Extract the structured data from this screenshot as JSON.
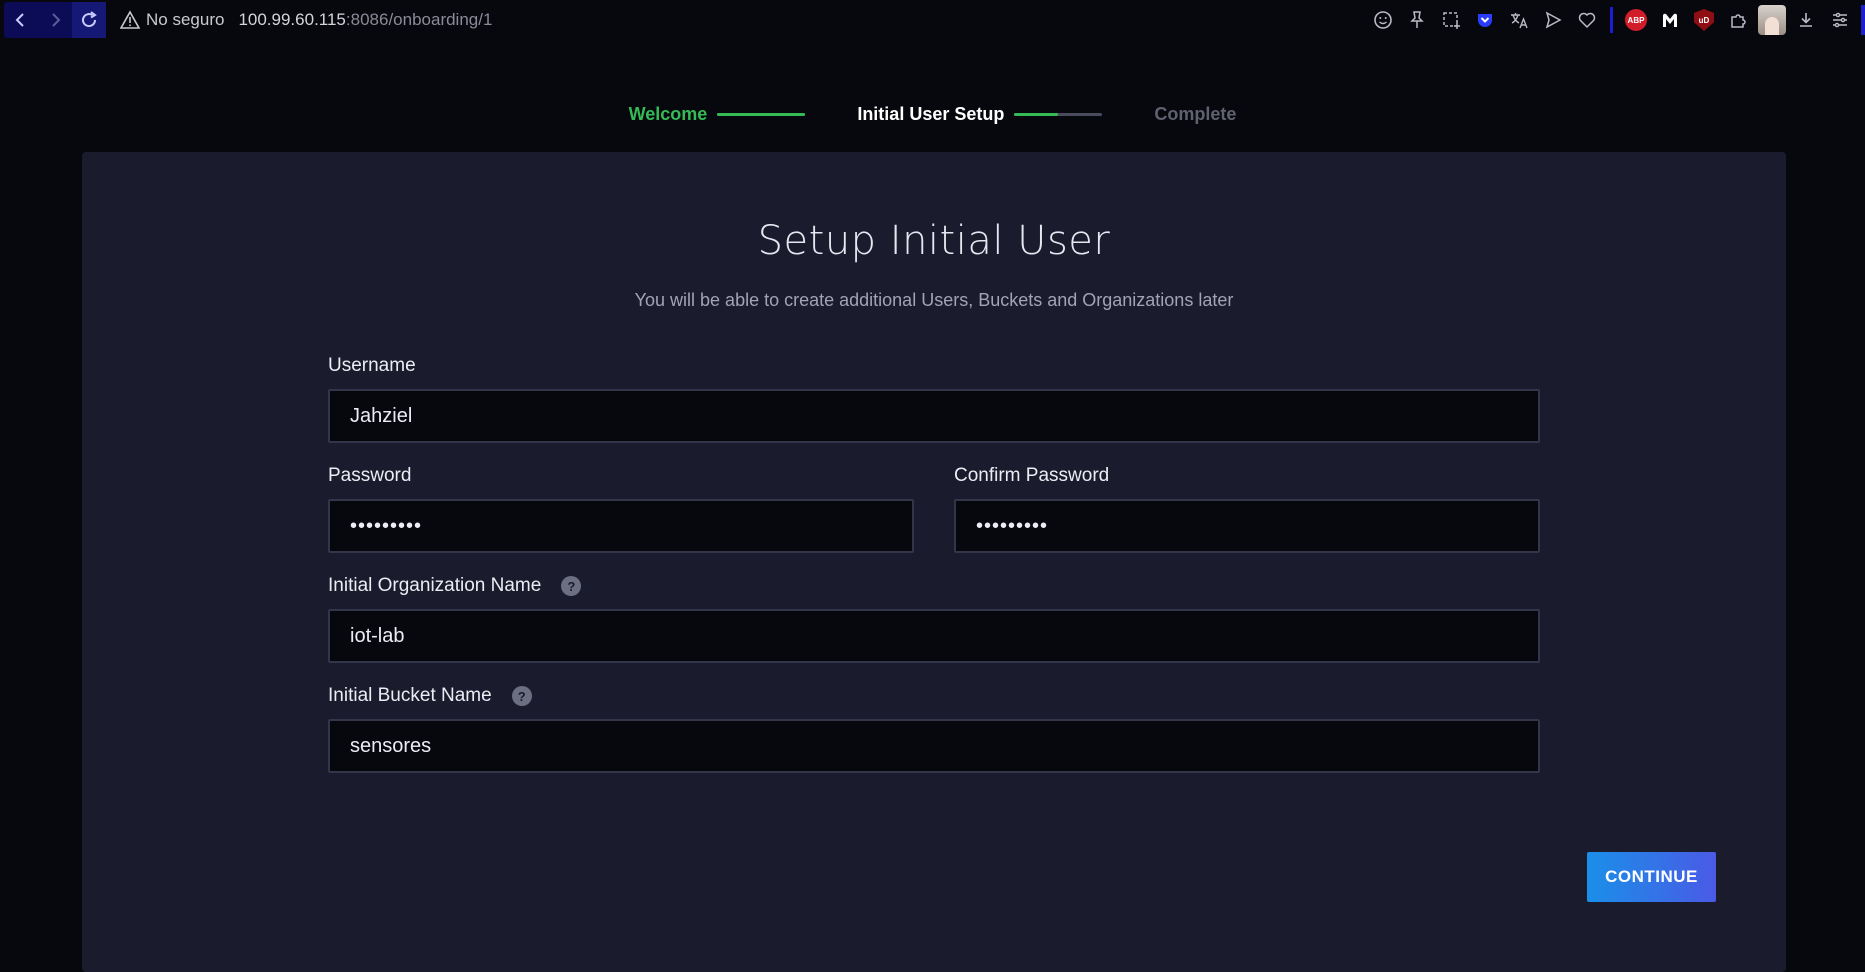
{
  "browser": {
    "security_label": "No seguro",
    "url_host": "100.99.60.115",
    "url_rest": ":8086/onboarding/1",
    "extensions": {
      "abp_label": "ABP",
      "ublock_label": "uD"
    }
  },
  "stepper": {
    "steps": [
      {
        "label": "Welcome",
        "state": "done",
        "progress": 1.0
      },
      {
        "label": "Initial User Setup",
        "state": "current",
        "progress": 0.5
      },
      {
        "label": "Complete",
        "state": "todo"
      }
    ]
  },
  "form": {
    "title": "Setup Initial User",
    "subtitle": "You will be able to create additional Users, Buckets and Organizations later",
    "username": {
      "label": "Username",
      "value": "Jahziel"
    },
    "password": {
      "label": "Password",
      "value": "•••••••••"
    },
    "confirm_password": {
      "label": "Confirm Password",
      "value": "•••••••••"
    },
    "org_name": {
      "label": "Initial Organization Name",
      "value": "iot-lab",
      "help": "?"
    },
    "bucket_name": {
      "label": "Initial Bucket Name",
      "value": "sensores",
      "help": "?"
    },
    "continue_label": "CONTINUE"
  },
  "colors": {
    "accent_green": "#34bb55",
    "panel_bg": "#1a1b2c",
    "button_gradient_start": "#1a8fe8",
    "button_gradient_end": "#4a5ae6"
  }
}
